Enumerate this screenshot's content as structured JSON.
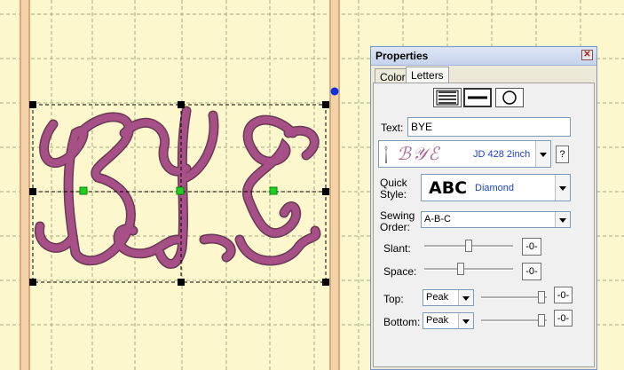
{
  "canvas": {
    "monogram_text": "BYE",
    "thread_color": "#a74f87"
  },
  "panel": {
    "title": "Properties",
    "close_glyph": "✕",
    "tabs": [
      {
        "label": "Color",
        "active": false
      },
      {
        "label": "Letters",
        "active": true
      }
    ],
    "frame_buttons": [
      {
        "icon": "lines-frame-icon"
      },
      {
        "icon": "single-line-frame-icon",
        "selected": true
      },
      {
        "icon": "circle-frame-icon"
      }
    ],
    "text_label": "Text:",
    "text_value": "BYE",
    "font": {
      "preview_text": "ℬ𝒴ℰ",
      "name": "JD 428 2inch",
      "help": "?"
    },
    "quick_style": {
      "label_line1": "Quick",
      "label_line2": "Style:",
      "sample": "ABC",
      "value": "Diamond"
    },
    "sewing_order": {
      "label_line1": "Sewing",
      "label_line2": "Order:",
      "value": "A-B-C"
    },
    "slant": {
      "label": "Slant:",
      "reset": "-0-",
      "level": 0.5
    },
    "space": {
      "label": "Space:",
      "reset": "-0-",
      "level": 0.4
    },
    "top": {
      "label": "Top:",
      "value": "Peak",
      "reset": "-0-",
      "level": 0.97
    },
    "bottom": {
      "label": "Bottom:",
      "value": "Peak",
      "reset": "-0-",
      "level": 0.97
    },
    "colors": {
      "link_blue": "#1b3fd1",
      "title_bar": "#c5d3ec"
    }
  }
}
